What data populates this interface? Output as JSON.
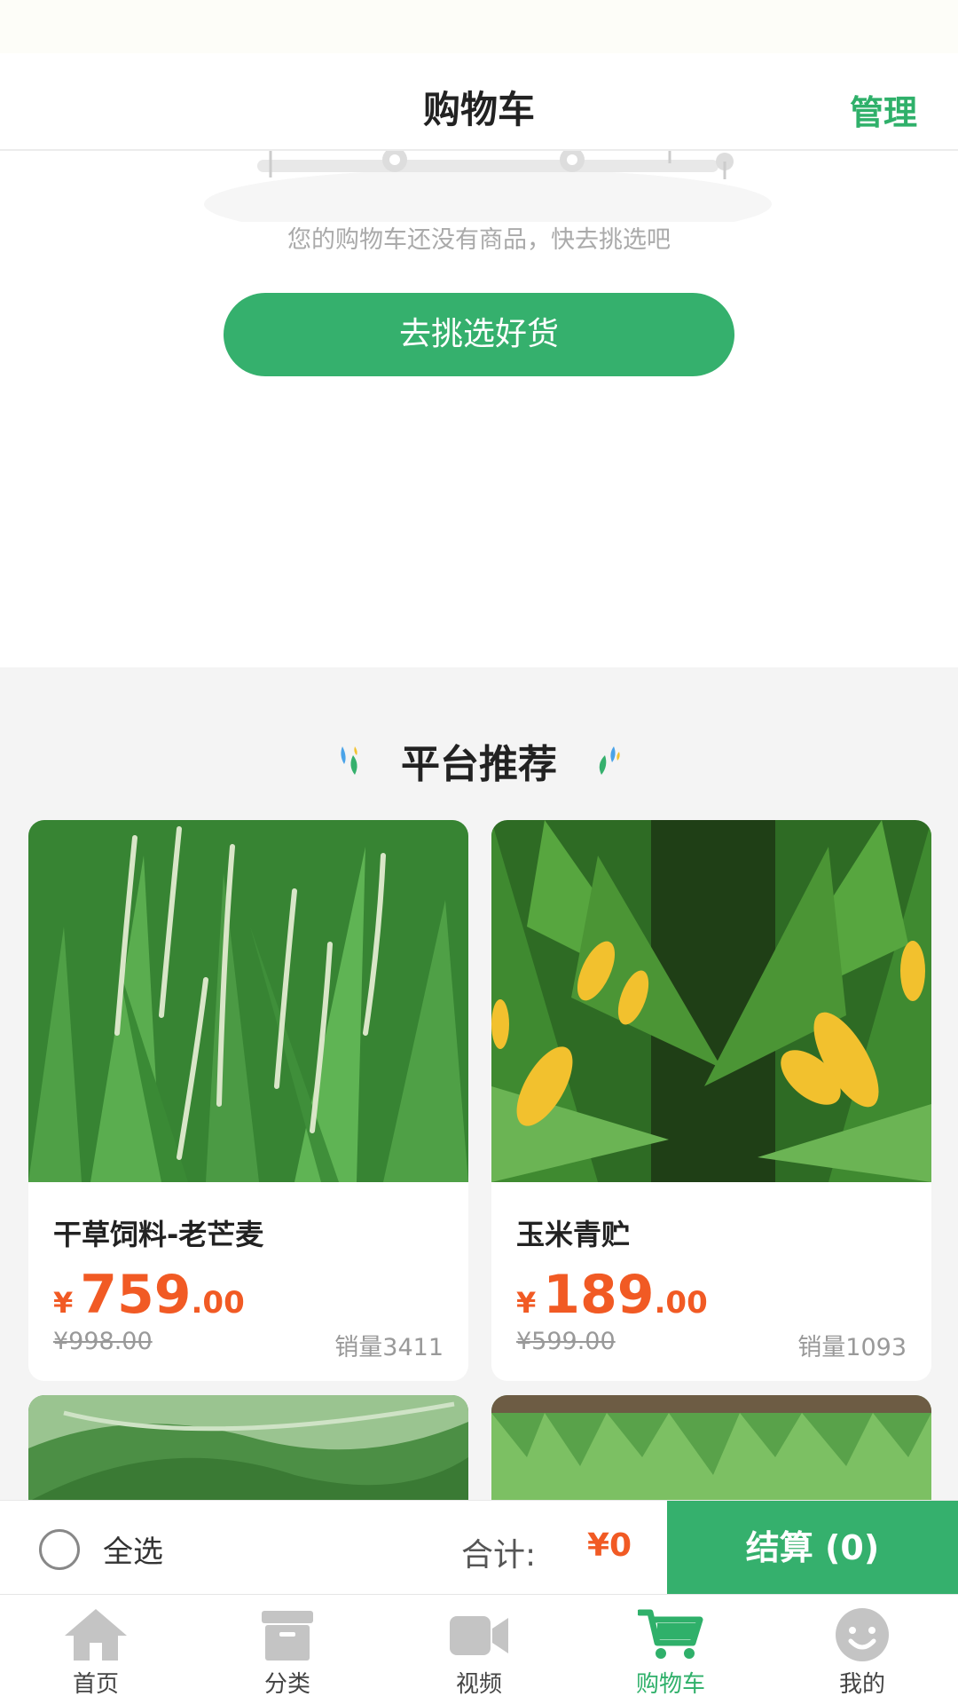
{
  "header": {
    "title": "购物车",
    "manage_label": "管理"
  },
  "empty_cart": {
    "message": "您的购物车还没有商品，快去挑选吧",
    "button_label": "去挑选好货"
  },
  "recommend": {
    "title": "平台推荐",
    "products": [
      {
        "name": "干草饲料-老芒麦",
        "currency": "¥",
        "price_int": "759",
        "price_dec": ".00",
        "original_price": "¥998.00",
        "sales": "销量3411",
        "image": "wild-rye-grass"
      },
      {
        "name": "玉米青贮",
        "currency": "¥",
        "price_int": "189",
        "price_dec": ".00",
        "original_price": "¥599.00",
        "sales": "销量1093",
        "image": "corn-field"
      }
    ]
  },
  "checkout": {
    "select_all_label": "全选",
    "total_label": "合计:",
    "total_value": "¥0",
    "button_label": "结算 (0)"
  },
  "tabbar": {
    "items": [
      {
        "label": "首页",
        "icon": "home-icon"
      },
      {
        "label": "分类",
        "icon": "category-icon"
      },
      {
        "label": "视频",
        "icon": "video-icon"
      },
      {
        "label": "购物车",
        "icon": "cart-icon",
        "active": true
      },
      {
        "label": "我的",
        "icon": "profile-icon"
      }
    ]
  },
  "colors": {
    "brand_green": "#35b06d",
    "price_orange": "#f15a24",
    "tab_inactive": "#c4c4c4"
  }
}
